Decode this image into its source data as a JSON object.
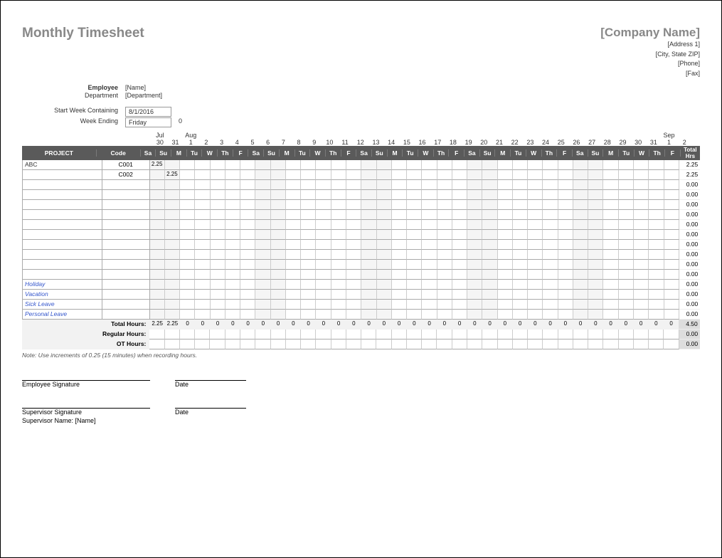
{
  "title": "Monthly Timesheet",
  "company": {
    "name": "[Company Name]",
    "addr1": "[Address 1]",
    "addr2": "[City, State ZIP]",
    "phone": "[Phone]",
    "fax": "[Fax]"
  },
  "info": {
    "employee_label": "Employee",
    "employee_value": "[Name]",
    "department_label": "Department",
    "department_value": "[Department]",
    "start_label": "Start Week Containing",
    "start_value": "8/1/2016",
    "ending_label": "Week Ending",
    "ending_value": "Friday",
    "ending_num": "0"
  },
  "months": [
    "",
    "",
    "Jul",
    "",
    "Aug",
    "",
    "",
    "",
    "",
    "",
    "",
    "",
    "",
    "",
    "",
    "",
    "",
    "",
    "",
    "",
    "",
    "",
    "",
    "",
    "",
    "",
    "",
    "",
    "",
    "",
    "",
    "",
    "",
    "",
    "",
    "Sep",
    ""
  ],
  "dates_idx": [
    "",
    "",
    "30",
    "31",
    "1",
    "2",
    "3",
    "4",
    "5",
    "6",
    "7",
    "8",
    "9",
    "10",
    "11",
    "12",
    "13",
    "14",
    "15",
    "16",
    "17",
    "18",
    "19",
    "20",
    "21",
    "22",
    "23",
    "24",
    "25",
    "26",
    "27",
    "28",
    "29",
    "30",
    "31",
    "1",
    "2"
  ],
  "dow": [
    "Sa",
    "Su",
    "M",
    "Tu",
    "W",
    "Th",
    "F",
    "Sa",
    "Su",
    "M",
    "Tu",
    "W",
    "Th",
    "F",
    "Sa",
    "Su",
    "M",
    "Tu",
    "W",
    "Th",
    "F",
    "Sa",
    "Su",
    "M",
    "Tu",
    "W",
    "Th",
    "F",
    "Sa",
    "Su",
    "M",
    "Tu",
    "W",
    "Th",
    "F"
  ],
  "hdr": {
    "project": "PROJECT",
    "code": "Code",
    "total": "Total Hrs"
  },
  "rows": [
    {
      "proj": "ABC",
      "code": "C001",
      "cells": [
        "2.25",
        "",
        "",
        "",
        "",
        "",
        "",
        "",
        "",
        "",
        "",
        "",
        "",
        "",
        "",
        "",
        "",
        "",
        "",
        "",
        "",
        "",
        "",
        "",
        "",
        "",
        "",
        "",
        "",
        "",
        "",
        "",
        "",
        "",
        ""
      ],
      "total": "2.25"
    },
    {
      "proj": "",
      "code": "C002",
      "cells": [
        "",
        "2.25",
        "",
        "",
        "",
        "",
        "",
        "",
        "",
        "",
        "",
        "",
        "",
        "",
        "",
        "",
        "",
        "",
        "",
        "",
        "",
        "",
        "",
        "",
        "",
        "",
        "",
        "",
        "",
        "",
        "",
        "",
        "",
        "",
        ""
      ],
      "total": "2.25"
    },
    {
      "proj": "",
      "code": "",
      "cells": [
        "",
        "",
        "",
        "",
        "",
        "",
        "",
        "",
        "",
        "",
        "",
        "",
        "",
        "",
        "",
        "",
        "",
        "",
        "",
        "",
        "",
        "",
        "",
        "",
        "",
        "",
        "",
        "",
        "",
        "",
        "",
        "",
        "",
        "",
        ""
      ],
      "total": "0.00"
    },
    {
      "proj": "",
      "code": "",
      "cells": [
        "",
        "",
        "",
        "",
        "",
        "",
        "",
        "",
        "",
        "",
        "",
        "",
        "",
        "",
        "",
        "",
        "",
        "",
        "",
        "",
        "",
        "",
        "",
        "",
        "",
        "",
        "",
        "",
        "",
        "",
        "",
        "",
        "",
        "",
        ""
      ],
      "total": "0.00"
    },
    {
      "proj": "",
      "code": "",
      "cells": [
        "",
        "",
        "",
        "",
        "",
        "",
        "",
        "",
        "",
        "",
        "",
        "",
        "",
        "",
        "",
        "",
        "",
        "",
        "",
        "",
        "",
        "",
        "",
        "",
        "",
        "",
        "",
        "",
        "",
        "",
        "",
        "",
        "",
        "",
        ""
      ],
      "total": "0.00"
    },
    {
      "proj": "",
      "code": "",
      "cells": [
        "",
        "",
        "",
        "",
        "",
        "",
        "",
        "",
        "",
        "",
        "",
        "",
        "",
        "",
        "",
        "",
        "",
        "",
        "",
        "",
        "",
        "",
        "",
        "",
        "",
        "",
        "",
        "",
        "",
        "",
        "",
        "",
        "",
        "",
        ""
      ],
      "total": "0.00"
    },
    {
      "proj": "",
      "code": "",
      "cells": [
        "",
        "",
        "",
        "",
        "",
        "",
        "",
        "",
        "",
        "",
        "",
        "",
        "",
        "",
        "",
        "",
        "",
        "",
        "",
        "",
        "",
        "",
        "",
        "",
        "",
        "",
        "",
        "",
        "",
        "",
        "",
        "",
        "",
        "",
        ""
      ],
      "total": "0.00"
    },
    {
      "proj": "",
      "code": "",
      "cells": [
        "",
        "",
        "",
        "",
        "",
        "",
        "",
        "",
        "",
        "",
        "",
        "",
        "",
        "",
        "",
        "",
        "",
        "",
        "",
        "",
        "",
        "",
        "",
        "",
        "",
        "",
        "",
        "",
        "",
        "",
        "",
        "",
        "",
        "",
        ""
      ],
      "total": "0.00"
    },
    {
      "proj": "",
      "code": "",
      "cells": [
        "",
        "",
        "",
        "",
        "",
        "",
        "",
        "",
        "",
        "",
        "",
        "",
        "",
        "",
        "",
        "",
        "",
        "",
        "",
        "",
        "",
        "",
        "",
        "",
        "",
        "",
        "",
        "",
        "",
        "",
        "",
        "",
        "",
        "",
        ""
      ],
      "total": "0.00"
    },
    {
      "proj": "",
      "code": "",
      "cells": [
        "",
        "",
        "",
        "",
        "",
        "",
        "",
        "",
        "",
        "",
        "",
        "",
        "",
        "",
        "",
        "",
        "",
        "",
        "",
        "",
        "",
        "",
        "",
        "",
        "",
        "",
        "",
        "",
        "",
        "",
        "",
        "",
        "",
        "",
        ""
      ],
      "total": "0.00"
    },
    {
      "proj": "",
      "code": "",
      "cells": [
        "",
        "",
        "",
        "",
        "",
        "",
        "",
        "",
        "",
        "",
        "",
        "",
        "",
        "",
        "",
        "",
        "",
        "",
        "",
        "",
        "",
        "",
        "",
        "",
        "",
        "",
        "",
        "",
        "",
        "",
        "",
        "",
        "",
        "",
        ""
      ],
      "total": "0.00"
    },
    {
      "proj": "",
      "code": "",
      "cells": [
        "",
        "",
        "",
        "",
        "",
        "",
        "",
        "",
        "",
        "",
        "",
        "",
        "",
        "",
        "",
        "",
        "",
        "",
        "",
        "",
        "",
        "",
        "",
        "",
        "",
        "",
        "",
        "",
        "",
        "",
        "",
        "",
        "",
        "",
        ""
      ],
      "total": "0.00"
    },
    {
      "proj": "Holiday",
      "blue": true,
      "code": "",
      "cells": [
        "",
        "",
        "",
        "",
        "",
        "",
        "",
        "",
        "",
        "",
        "",
        "",
        "",
        "",
        "",
        "",
        "",
        "",
        "",
        "",
        "",
        "",
        "",
        "",
        "",
        "",
        "",
        "",
        "",
        "",
        "",
        "",
        "",
        "",
        ""
      ],
      "total": "0.00"
    },
    {
      "proj": "Vacation",
      "blue": true,
      "code": "",
      "cells": [
        "",
        "",
        "",
        "",
        "",
        "",
        "",
        "",
        "",
        "",
        "",
        "",
        "",
        "",
        "",
        "",
        "",
        "",
        "",
        "",
        "",
        "",
        "",
        "",
        "",
        "",
        "",
        "",
        "",
        "",
        "",
        "",
        "",
        "",
        ""
      ],
      "total": "0.00"
    },
    {
      "proj": "Sick Leave",
      "blue": true,
      "code": "",
      "cells": [
        "",
        "",
        "",
        "",
        "",
        "",
        "",
        "",
        "",
        "",
        "",
        "",
        "",
        "",
        "",
        "",
        "",
        "",
        "",
        "",
        "",
        "",
        "",
        "",
        "",
        "",
        "",
        "",
        "",
        "",
        "",
        "",
        "",
        "",
        ""
      ],
      "total": "0.00"
    },
    {
      "proj": "Personal Leave",
      "blue": true,
      "code": "",
      "cells": [
        "",
        "",
        "",
        "",
        "",
        "",
        "",
        "",
        "",
        "",
        "",
        "",
        "",
        "",
        "",
        "",
        "",
        "",
        "",
        "",
        "",
        "",
        "",
        "",
        "",
        "",
        "",
        "",
        "",
        "",
        "",
        "",
        "",
        "",
        ""
      ],
      "total": "0.00"
    }
  ],
  "totals": {
    "total_hours_label": "Total Hours:",
    "total_hours": [
      "2.25",
      "2.25",
      "0",
      "0",
      "0",
      "0",
      "0",
      "0",
      "0",
      "0",
      "0",
      "0",
      "0",
      "0",
      "0",
      "0",
      "0",
      "0",
      "0",
      "0",
      "0",
      "0",
      "0",
      "0",
      "0",
      "0",
      "0",
      "0",
      "0",
      "0",
      "0",
      "0",
      "0",
      "0",
      "0"
    ],
    "total_hours_sum": "4.50",
    "regular_label": "Regular Hours:",
    "regular": [
      "",
      "",
      "",
      "",
      "",
      "",
      "",
      "",
      "",
      "",
      "",
      "",
      "",
      "",
      "",
      "",
      "",
      "",
      "",
      "",
      "",
      "",
      "",
      "",
      "",
      "",
      "",
      "",
      "",
      "",
      "",
      "",
      "",
      "",
      ""
    ],
    "regular_sum": "0.00",
    "ot_label": "OT Hours:",
    "ot": [
      "",
      "",
      "",
      "",
      "",
      "",
      "",
      "",
      "",
      "",
      "",
      "",
      "",
      "",
      "",
      "",
      "",
      "",
      "",
      "",
      "",
      "",
      "",
      "",
      "",
      "",
      "",
      "",
      "",
      "",
      "",
      "",
      "",
      "",
      ""
    ],
    "ot_sum": "0.00"
  },
  "note": "Note: Use increments of 0.25 (15 minutes) when recording hours.",
  "sig": {
    "emp": "Employee Signature",
    "date": "Date",
    "sup": "Supervisor Signature",
    "sup_name_label": "Supervisor Name:",
    "sup_name": "[Name]"
  }
}
